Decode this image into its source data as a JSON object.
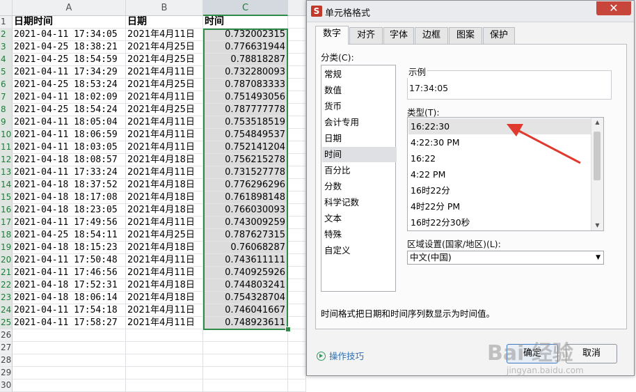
{
  "sheet": {
    "columns": [
      {
        "letter": "A",
        "header": "日期时间"
      },
      {
        "letter": "B",
        "header": "日期"
      },
      {
        "letter": "C",
        "header": "时间"
      }
    ],
    "row_numbers": [
      "1",
      "2",
      "3",
      "4",
      "5",
      "6",
      "7",
      "8",
      "9",
      "10",
      "11",
      "12",
      "13",
      "14",
      "15",
      "16",
      "17",
      "18",
      "19",
      "20",
      "21",
      "22",
      "23",
      "24",
      "25",
      "26",
      "27",
      "28",
      "29",
      "30"
    ],
    "rows": [
      [
        "2021-04-11 17:34:05",
        "2021年4月11日",
        "0.732002315"
      ],
      [
        "2021-04-25 18:38:21",
        "2021年4月25日",
        "0.776631944"
      ],
      [
        "2021-04-25 18:54:59",
        "2021年4月25日",
        "0.78818287"
      ],
      [
        "2021-04-11 17:34:29",
        "2021年4月11日",
        "0.732280093"
      ],
      [
        "2021-04-25 18:53:24",
        "2021年4月25日",
        "0.787083333"
      ],
      [
        "2021-04-11 18:02:09",
        "2021年4月11日",
        "0.751493056"
      ],
      [
        "2021-04-25 18:54:24",
        "2021年4月25日",
        "0.787777778"
      ],
      [
        "2021-04-11 18:05:04",
        "2021年4月11日",
        "0.753518519"
      ],
      [
        "2021-04-11 18:06:59",
        "2021年4月11日",
        "0.754849537"
      ],
      [
        "2021-04-11 18:03:05",
        "2021年4月11日",
        "0.752141204"
      ],
      [
        "2021-04-18 18:08:57",
        "2021年4月18日",
        "0.756215278"
      ],
      [
        "2021-04-11 17:33:24",
        "2021年4月11日",
        "0.731527778"
      ],
      [
        "2021-04-18 18:37:52",
        "2021年4月18日",
        "0.776296296"
      ],
      [
        "2021-04-18 18:17:08",
        "2021年4月18日",
        "0.761898148"
      ],
      [
        "2021-04-18 18:23:05",
        "2021年4月18日",
        "0.766030093"
      ],
      [
        "2021-04-11 17:49:56",
        "2021年4月11日",
        "0.743009259"
      ],
      [
        "2021-04-25 18:54:11",
        "2021年4月25日",
        "0.787627315"
      ],
      [
        "2021-04-18 18:15:23",
        "2021年4月18日",
        "0.76068287"
      ],
      [
        "2021-04-11 17:50:48",
        "2021年4月11日",
        "0.743611111"
      ],
      [
        "2021-04-11 17:46:56",
        "2021年4月11日",
        "0.740925926"
      ],
      [
        "2021-04-18 17:52:31",
        "2021年4月18日",
        "0.744803241"
      ],
      [
        "2021-04-18 18:06:14",
        "2021年4月18日",
        "0.754328704"
      ],
      [
        "2021-04-11 17:54:18",
        "2021年4月11日",
        "0.746041667"
      ],
      [
        "2021-04-11 17:58:27",
        "2021年4月11日",
        "0.748923611"
      ]
    ]
  },
  "dialog": {
    "title": "单元格格式",
    "app_logo": "S",
    "close_glyph": "✕",
    "tabs": [
      "数字",
      "对齐",
      "字体",
      "边框",
      "图案",
      "保护"
    ],
    "active_tab": 0,
    "category_label": "分类(C):",
    "categories": [
      "常规",
      "数值",
      "货币",
      "会计专用",
      "日期",
      "时间",
      "百分比",
      "分数",
      "科学记数",
      "文本",
      "特殊",
      "自定义"
    ],
    "selected_category": 5,
    "sample_label": "示例",
    "sample_value": "17:34:05",
    "type_label": "类型(T):",
    "types": [
      "16:22:30",
      "4:22:30 PM",
      "16:22",
      "4:22 PM",
      "16时22分",
      "4时22分 PM",
      "16时22分30秒"
    ],
    "selected_type": 0,
    "locale_label": "区域设置(国家/地区)(L):",
    "locale_value": "中文(中国)",
    "description": "时间格式把日期和时间序列数显示为时间值。",
    "tips_label": "操作技巧",
    "ok_label": "确定",
    "cancel_label": "取消"
  },
  "watermark": {
    "text": "Bai 经验",
    "url": "jingyan.baidu.com"
  },
  "colors": {
    "selection_green": "#2e8b47",
    "close_red": "#c7453b",
    "arrow_red": "#e03a2f",
    "link_blue": "#2a6fb5"
  }
}
